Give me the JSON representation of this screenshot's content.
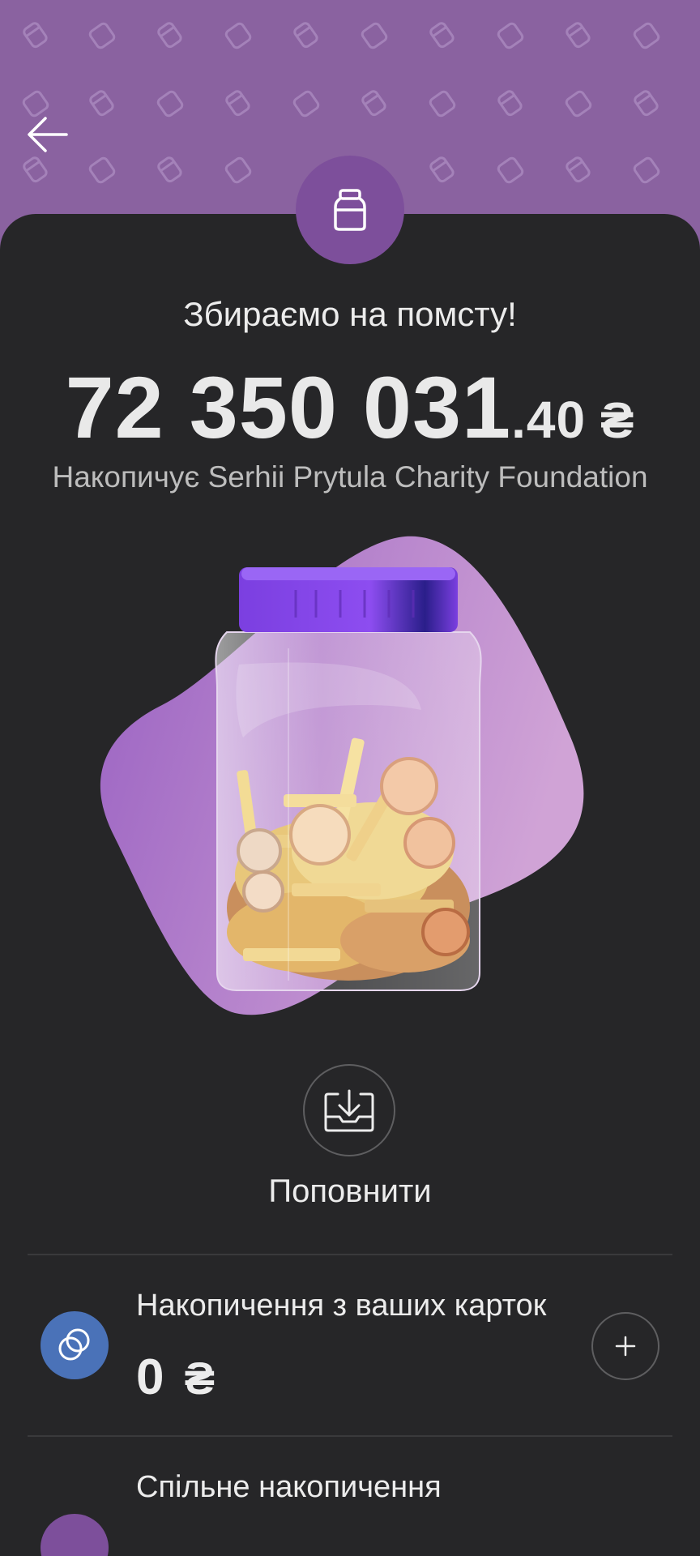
{
  "jar": {
    "title": "Збираємо на помсту!",
    "amount_main": "72 350 031",
    "amount_decimal": ".40",
    "currency": "₴",
    "owner": "Накопичує Serhii Prytula Charity Foundation"
  },
  "actions": {
    "topup_label": "Поповнити"
  },
  "savings": [
    {
      "title": "Накопичення з ваших карток",
      "amount": "0",
      "currency": "₴"
    },
    {
      "title": "Спільне накопичення"
    }
  ],
  "colors": {
    "header_bg": "#8a62a0",
    "sheet_bg": "#262628",
    "jar_badge": "#7d4f9b",
    "cards_icon_bg": "#4a72b8",
    "shared_icon_bg": "#7d4f9b"
  },
  "icons": [
    "back-arrow-icon",
    "jar-icon",
    "download-tray-icon",
    "cards-icon",
    "plus-icon"
  ]
}
